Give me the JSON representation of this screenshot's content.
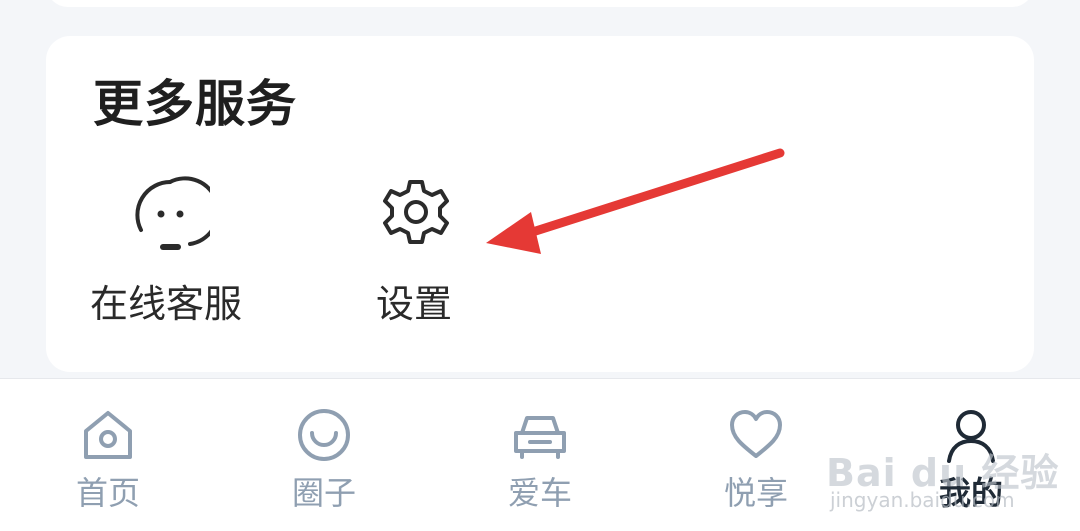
{
  "services": {
    "title": "更多服务",
    "items": [
      {
        "label": "在线客服",
        "icon": "headset-icon"
      },
      {
        "label": "设置",
        "icon": "gear-icon"
      }
    ]
  },
  "annotation": {
    "color": "#e53935"
  },
  "tabbar": {
    "tabs": [
      {
        "label": "首页",
        "icon": "home-icon",
        "active": false
      },
      {
        "label": "圈子",
        "icon": "circle-smile-icon",
        "active": false
      },
      {
        "label": "爱车",
        "icon": "car-icon",
        "active": false
      },
      {
        "label": "悦享",
        "icon": "heart-icon",
        "active": false
      },
      {
        "label": "我的",
        "icon": "user-icon",
        "active": true
      }
    ],
    "inactive_color": "#8f9fb1",
    "active_color": "#1f2a36"
  },
  "watermark": {
    "text": "Bai du 经验",
    "sub": "jingyan.baidu.com"
  }
}
